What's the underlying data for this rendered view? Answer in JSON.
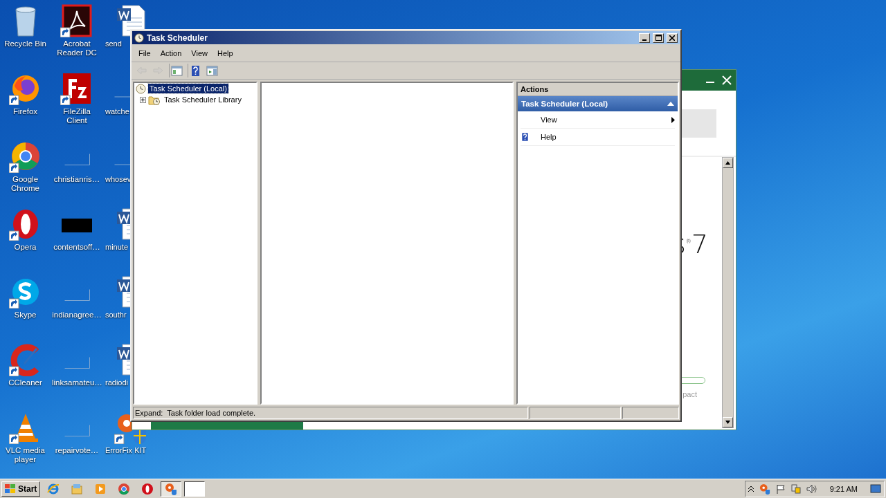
{
  "desktop_icons": [
    {
      "label": "Recycle Bin",
      "kind": "recycle",
      "shortcut": false
    },
    {
      "label": "Firefox",
      "kind": "firefox",
      "shortcut": true
    },
    {
      "label": "Google Chrome",
      "kind": "chrome",
      "shortcut": true
    },
    {
      "label": "Opera",
      "kind": "opera",
      "shortcut": true
    },
    {
      "label": "Skype",
      "kind": "skype",
      "shortcut": true
    },
    {
      "label": "CCleaner",
      "kind": "ccleaner",
      "shortcut": true
    },
    {
      "label": "VLC media player",
      "kind": "vlc",
      "shortcut": true
    },
    {
      "label": "Acrobat Reader DC",
      "kind": "acrobat",
      "shortcut": true
    },
    {
      "label": "FileZilla Client",
      "kind": "filezilla",
      "shortcut": true
    },
    {
      "label": "christianris…",
      "kind": "blank",
      "shortcut": false
    },
    {
      "label": "contentsoff…",
      "kind": "black",
      "shortcut": false
    },
    {
      "label": "indianagree…",
      "kind": "blank",
      "shortcut": false
    },
    {
      "label": "linksamateu…",
      "kind": "blank",
      "shortcut": false
    },
    {
      "label": "repairvote…",
      "kind": "blank",
      "shortcut": false
    },
    {
      "label": "send",
      "kind": "word",
      "shortcut": false
    },
    {
      "label": "watche",
      "kind": "blank",
      "shortcut": false
    },
    {
      "label": "whosev",
      "kind": "blank",
      "shortcut": false
    },
    {
      "label": "minute",
      "kind": "word",
      "shortcut": false
    },
    {
      "label": "southr",
      "kind": "word",
      "shortcut": false
    },
    {
      "label": "radiodi",
      "kind": "word",
      "shortcut": false
    },
    {
      "label": "ErrorFix KIT",
      "kind": "errorfix",
      "shortcut": true
    }
  ],
  "background_window": {
    "logo_text": "s$^{®}$7",
    "caption": "pact"
  },
  "window": {
    "title": "Task Scheduler",
    "menu": [
      "File",
      "Action",
      "View",
      "Help"
    ],
    "toolbar": [
      {
        "kind": "back",
        "disabled": true
      },
      {
        "kind": "forward",
        "disabled": true
      },
      {
        "kind": "console_tree",
        "disabled": false
      },
      {
        "kind": "help",
        "disabled": false
      },
      {
        "kind": "action_pane",
        "disabled": false
      }
    ],
    "tree": [
      {
        "label": "Task Scheduler (Local)",
        "selected": true,
        "children": [
          {
            "label": "Task Scheduler Library",
            "selected": false,
            "expanded": false
          }
        ]
      }
    ],
    "actions": {
      "title": "Actions",
      "section": "Task Scheduler (Local)",
      "items": [
        {
          "label": "View",
          "kind": "submenu"
        },
        {
          "label": "Help",
          "kind": "help"
        }
      ]
    },
    "status_bar": {
      "text": "Expand:  Task folder load complete."
    }
  },
  "taskbar": {
    "start": "Start",
    "clock": "9:21 AM",
    "apps": [
      {
        "kind": "ie",
        "selected": false
      },
      {
        "kind": "explorer",
        "selected": false
      },
      {
        "kind": "media",
        "selected": false
      },
      {
        "kind": "chrome",
        "selected": false
      },
      {
        "kind": "opera",
        "selected": false
      },
      {
        "kind": "errorfix",
        "selected": true
      },
      {
        "kind": "blank",
        "selected": false
      }
    ]
  }
}
